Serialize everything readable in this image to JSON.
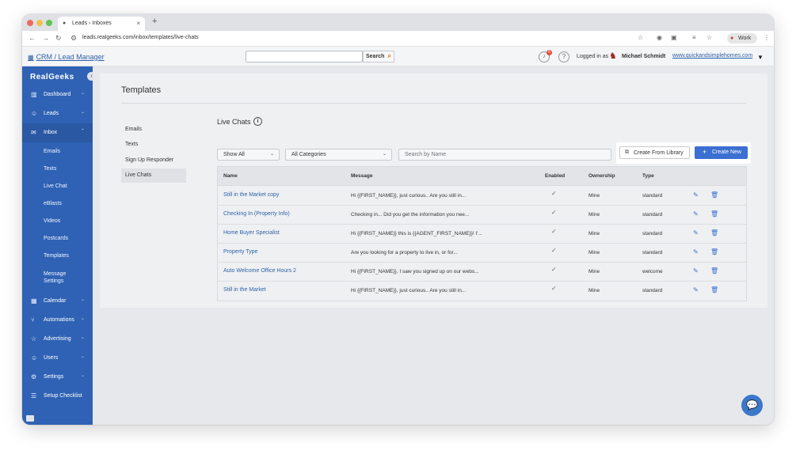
{
  "browser": {
    "tab_title": "Leads › Inboxes",
    "url": "leads.realgeeks.com/inbox/templates/live-chats",
    "profile": "Work"
  },
  "header": {
    "crm_link": "CRM / Lead Manager",
    "search_button": "Search",
    "notification_count": "6",
    "logged_in_label": "Logged in as",
    "user_name": "Michael Schmidt",
    "site_link": "www.quickandsimplehomes.com"
  },
  "sidebar": {
    "logo": "RealGeeks",
    "items": [
      {
        "label": "Dashboard"
      },
      {
        "label": "Leads"
      },
      {
        "label": "Inbox"
      },
      {
        "label": "Calendar"
      },
      {
        "label": "Automations"
      },
      {
        "label": "Advertising"
      },
      {
        "label": "Users"
      },
      {
        "label": "Settings"
      },
      {
        "label": "Setup Checklist"
      }
    ],
    "inbox_sub": [
      {
        "label": "Emails"
      },
      {
        "label": "Texts"
      },
      {
        "label": "Live Chat"
      },
      {
        "label": "eBlasts"
      },
      {
        "label": "Videos"
      },
      {
        "label": "Postcards"
      },
      {
        "label": "Templates"
      },
      {
        "label": "Message"
      },
      {
        "label": "Settings"
      }
    ]
  },
  "page": {
    "title": "Templates",
    "subnav": [
      {
        "label": "Emails"
      },
      {
        "label": "Texts"
      },
      {
        "label": "Sign Up Responder"
      },
      {
        "label": "Live Chats"
      }
    ],
    "section_title": "Live Chats",
    "filters": {
      "show": "Show All",
      "category": "All Categories",
      "search_placeholder": "Search by Name"
    },
    "buttons": {
      "library": "Create From Library",
      "create": "Create New"
    }
  },
  "table": {
    "columns": [
      "Name",
      "Message",
      "Enabled",
      "Ownership",
      "Type"
    ],
    "rows": [
      {
        "name": "Still in the Market copy",
        "message": "Hi {{FIRST_NAME}}, just curious.. Are you still in...",
        "enabled": "✓",
        "ownership": "Mine",
        "type": "standard"
      },
      {
        "name": "Checking In (Property Info)",
        "message": "Checking in... Did you get the information you nee...",
        "enabled": "✓",
        "ownership": "Mine",
        "type": "standard"
      },
      {
        "name": "Home Buyer Specialist",
        "message": "Hi {{FIRST_NAME}} this is {{AGENT_FIRST_NAME}}! I'...",
        "enabled": "✓",
        "ownership": "Mine",
        "type": "standard"
      },
      {
        "name": "Property Type",
        "message": "Are you looking for a property to live in, or for...",
        "enabled": "✓",
        "ownership": "Mine",
        "type": "standard"
      },
      {
        "name": "Auto Welcome Office Hours 2",
        "message": "Hi {{FIRST_NAME}}, I saw you signed up on our webs...",
        "enabled": "✓",
        "ownership": "Mine",
        "type": "welcome"
      },
      {
        "name": "Still in the Market",
        "message": "Hi {{FIRST_NAME}}, just curious.. Are you still in...",
        "enabled": "✓",
        "ownership": "Mine",
        "type": "standard"
      }
    ]
  },
  "colors": {
    "sidebar": "#2f62b4",
    "primary_button": "#3b6fd1",
    "link": "#2f62a8"
  }
}
